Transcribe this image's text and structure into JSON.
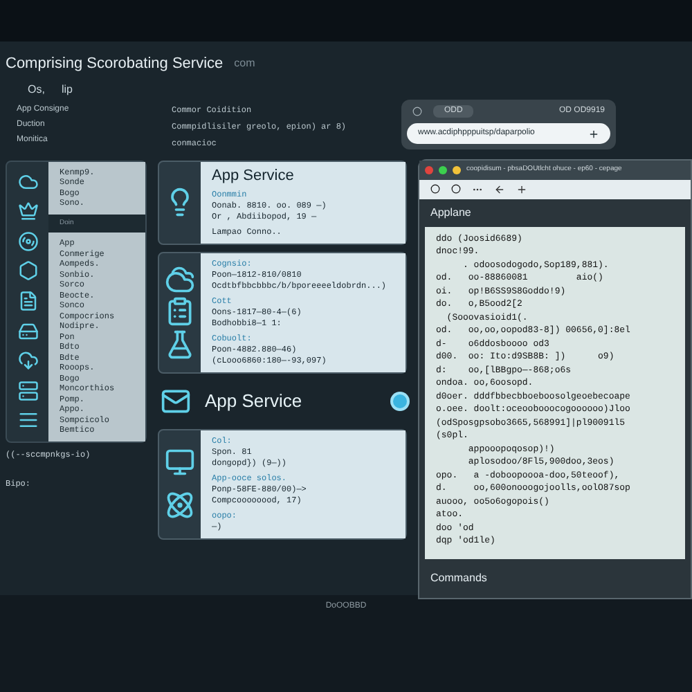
{
  "window": {
    "title": "Comprising Scorobating Service",
    "subtitle": "com"
  },
  "menu": [
    "Os,",
    "lip"
  ],
  "side_labels": [
    "App Consigne",
    "Duction",
    "Monitica"
  ],
  "header_lines": [
    "Commor Coidition",
    "Commpidlisiler greolo, epion) ar 8)",
    "conmacioc"
  ],
  "sidebar": {
    "groups": [
      {
        "items": [
          "Kenmp9.",
          "Sonde",
          "Bogo",
          "Sono."
        ]
      },
      {
        "label": "Doin",
        "items": [
          "App",
          "Conmerige",
          "Aompeds.",
          "Sonbio.",
          "Sorco",
          "Beocte.",
          "Sonco",
          "Compocrions",
          "Nodipre.",
          "Pon",
          "Bdto",
          "Bdte",
          "Rooops.",
          "Bogo",
          "Moncorthios",
          "Pomp.",
          "Appo.",
          "Sompcicolo",
          "Bemtico"
        ]
      }
    ]
  },
  "sidebar_footer": "((--sccmpnkgs-io)",
  "prompt": "Bipo:",
  "cards": [
    {
      "kind": "card",
      "title": "App Service",
      "sections": [
        {
          "label": "Oonmmin",
          "lines": [
            "Oonab. 8810. oo. 089 —)",
            "Or , Abdiibopod, 19 —"
          ]
        },
        {
          "lines": [
            "Lampao Conno.."
          ]
        }
      ]
    },
    {
      "kind": "card",
      "sections": [
        {
          "label": "Cognsio:",
          "lines": [
            "Poon—1812-810/0810",
            "Ocdtbfbbcbbbc/b/bporeeeeldobrdn...)"
          ]
        },
        {
          "label": "Cott",
          "lines": [
            "Oons-1817—80-4—(6)",
            "Bodhobbi8—1 1:"
          ]
        },
        {
          "label": "Cobuolt:",
          "lines": [
            "Poon-4882.880—46)",
            "(cLooo6860:180—-93,097)"
          ]
        }
      ]
    },
    {
      "kind": "heading",
      "title": "App Service",
      "active": true
    },
    {
      "kind": "card",
      "sections": [
        {
          "label": "Col:",
          "lines": [
            "Spon. 81",
            "dongopd}) (9—))"
          ]
        },
        {
          "label": "App-ooce solos.",
          "lines": [
            "Ponp-58FE-880/00)—>",
            "Compcoooooood, 17)"
          ]
        },
        {
          "label": "oopo:",
          "lines": [
            "—)"
          ]
        }
      ]
    }
  ],
  "popup": {
    "tab": "ODD",
    "status": "OD OD9919",
    "url": "www.acdiphpppuitsp/daparpolio"
  },
  "browser": {
    "tab": "coopidisum - pbsaDOUtlcht ohuce - ep60 - cepage",
    "section": "Applane",
    "code": [
      "ddo (Joosid6689)",
      "dnoc!99.",
      "     . odoosodogodo,Sop189,881).",
      "od.   oo-88860081         aio()",
      "oi.   op!B6SS9S8Goddo!9)",
      "do.   o,B5ood2[2",
      "  (Sooovasioid1(.",
      "od.   oo,oo,oopod83-8]) 00656,0]:8el",
      "d-    o6ddosboooo od3",
      "d00.  oo: Ito:d9SB8B: ])      o9)",
      "d:    oo,[lBBgpo—-868;o6s",
      "ondoa. oo,6oosopd.",
      "d0oer. dddfbbecbboeboosolgeoebecoape",
      "o.oee. doolt:oceoobooocogoooooo)Jloo",
      "(odSposgpsobo3665,568991]|pl90091l5",
      "(s0pl.",
      "      appooopoqosop)!)",
      "      aplosodoo/8Fl5,900doo,3eos)",
      "opo.   a -doboopoooa-doo,50teoof),",
      "d.     oo,600onooogojoolls,oolO87sop",
      "auooo, oo5o6ogopois()",
      "atoo.",
      "doo 'od",
      "dqp 'od1le)"
    ],
    "footer": "Commands"
  },
  "laptop_label": "DoOOBBD"
}
